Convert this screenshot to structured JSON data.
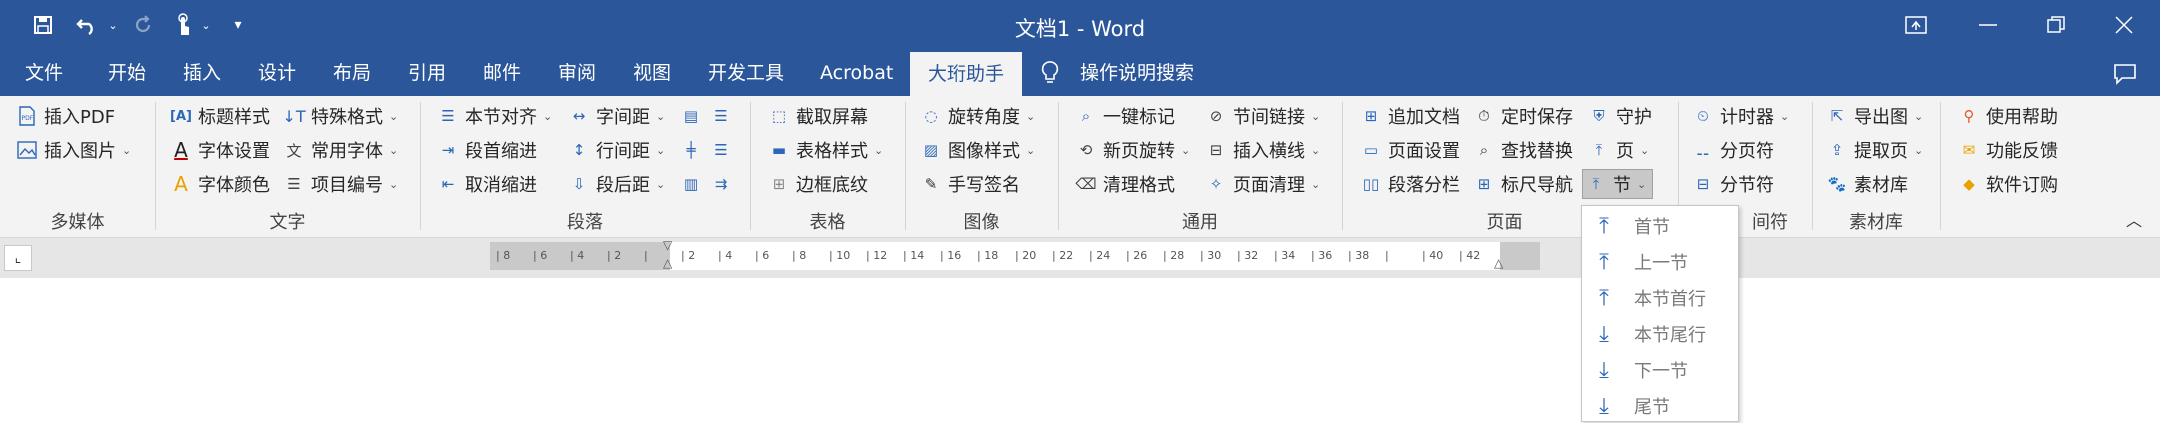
{
  "titlebar": {
    "doc_title": "文档1  -  Word",
    "quick_access": {
      "save_icon": "save-icon",
      "undo_icon": "undo-icon",
      "redo_icon": "redo-icon",
      "touch_icon": "touch-mode-icon",
      "customize_icon": "customize-qat-icon"
    },
    "window_icons": [
      "ribbon-display-icon",
      "minimize-icon",
      "restore-icon",
      "close-icon"
    ]
  },
  "tabs": [
    {
      "label": "文件"
    },
    {
      "label": "开始"
    },
    {
      "label": "插入"
    },
    {
      "label": "设计"
    },
    {
      "label": "布局"
    },
    {
      "label": "引用"
    },
    {
      "label": "邮件"
    },
    {
      "label": "审阅"
    },
    {
      "label": "视图"
    },
    {
      "label": "开发工具"
    },
    {
      "label": "Acrobat"
    },
    {
      "label": "大珩助手",
      "active": true
    },
    {
      "label": "操作说明搜索"
    }
  ],
  "ribbon": {
    "groups": {
      "multimedia": {
        "label": "多媒体",
        "items": [
          "插入PDF",
          "插入图片"
        ]
      },
      "text": {
        "label": "文字",
        "items": [
          "标题样式",
          "字体设置",
          "字体颜色",
          "特殊格式",
          "常用字体",
          "项目编号"
        ]
      },
      "paragraph": {
        "label": "段落",
        "items": [
          "本节对齐",
          "段首缩进",
          "取消缩进",
          "字间距",
          "行间距",
          "段后距"
        ]
      },
      "table": {
        "label": "表格",
        "items": [
          "截取屏幕",
          "表格样式",
          "边框底纹"
        ]
      },
      "image": {
        "label": "图像",
        "items": [
          "旋转角度",
          "图像样式",
          "手写签名"
        ]
      },
      "common": {
        "label": "通用",
        "items": [
          "一键标记",
          "新页旋转",
          "清理格式",
          "节间链接",
          "插入横线",
          "页面清理"
        ]
      },
      "page": {
        "label": "页面",
        "items": [
          "追加文档",
          "页面设置",
          "段落分栏",
          "定时保存",
          "查找替换",
          "标尺导航",
          "守护",
          "页",
          "节"
        ]
      },
      "separator": {
        "label_fragment": "间符",
        "items": [
          "计时器",
          "分页符",
          "分节符"
        ]
      },
      "library": {
        "label": "素材库",
        "items": [
          "导出图",
          "提取页",
          "素材库"
        ]
      },
      "help": {
        "items": [
          "使用帮助",
          "功能反馈",
          "软件订购"
        ]
      }
    }
  },
  "ruler": {
    "ticks": [
      "8",
      "6",
      "4",
      "2",
      "",
      "2",
      "4",
      "6",
      "8",
      "10",
      "12",
      "14",
      "16",
      "18",
      "20",
      "22",
      "24",
      "26",
      "28",
      "30",
      "32",
      "34",
      "36",
      "38",
      "",
      "40",
      "42"
    ]
  },
  "dropdown": {
    "items": [
      {
        "label": "首节",
        "icon": "arrow-to-top-icon"
      },
      {
        "label": "上一节",
        "icon": "arrow-to-top-icon"
      },
      {
        "label": "本节首行",
        "icon": "arrow-to-top-icon"
      },
      {
        "label": "本节尾行",
        "icon": "arrow-to-bottom-icon"
      },
      {
        "label": "下一节",
        "icon": "arrow-to-bottom-icon"
      },
      {
        "label": "尾节",
        "icon": "arrow-to-bottom-icon"
      }
    ]
  },
  "colors": {
    "title_bar": "#2b579a",
    "ribbon_bg": "#f3f3f3",
    "accent_icon": "#2b66b8"
  }
}
